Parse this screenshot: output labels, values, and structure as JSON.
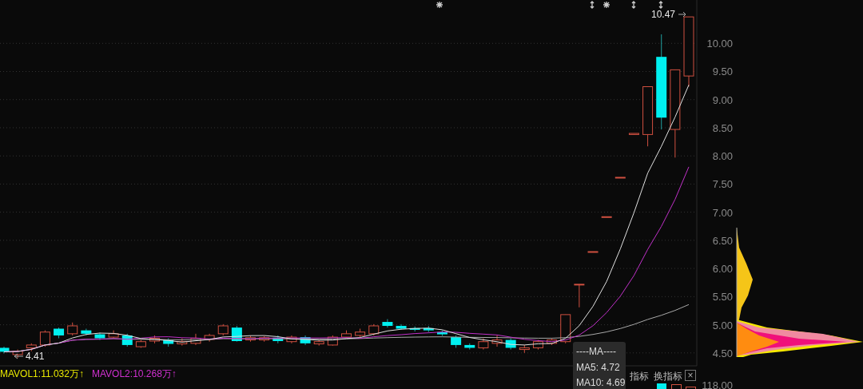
{
  "chart": {
    "high_label": "10.47",
    "low_label": "4.41",
    "chart_data": {
      "type": "candlestick",
      "grid": true,
      "ylim": [
        4.27,
        10.77
      ],
      "yticks": [
        {
          "value": 4.5,
          "label": "4.50"
        },
        {
          "value": 5,
          "label": "5.00"
        },
        {
          "value": 5.5,
          "label": "5.50"
        },
        {
          "value": 6,
          "label": "6.00"
        },
        {
          "value": 6.5,
          "label": "6.50"
        },
        {
          "value": 7,
          "label": "7.00"
        },
        {
          "value": 7.5,
          "label": "7.50"
        },
        {
          "value": 8,
          "label": "8.00"
        },
        {
          "value": 8.5,
          "label": "8.50"
        },
        {
          "value": 9,
          "label": "9.00"
        },
        {
          "value": 9.5,
          "label": "9.50"
        },
        {
          "value": 10,
          "label": "10.00"
        }
      ],
      "ohlc": [
        [
          4.59,
          4.61,
          4.49,
          4.52
        ],
        [
          4.47,
          4.56,
          4.41,
          4.53
        ],
        [
          4.59,
          4.67,
          4.53,
          4.64
        ],
        [
          4.64,
          4.9,
          4.61,
          4.87
        ],
        [
          4.93,
          4.95,
          4.76,
          4.81
        ],
        [
          4.84,
          5.04,
          4.81,
          4.98
        ],
        [
          4.9,
          4.93,
          4.81,
          4.84
        ],
        [
          4.83,
          4.86,
          4.73,
          4.76
        ],
        [
          4.78,
          4.9,
          4.76,
          4.84
        ],
        [
          4.81,
          4.84,
          4.61,
          4.64
        ],
        [
          4.61,
          4.73,
          4.59,
          4.7
        ],
        [
          4.71,
          4.81,
          4.67,
          4.76
        ],
        [
          4.73,
          4.76,
          4.61,
          4.66
        ],
        [
          4.66,
          4.76,
          4.63,
          4.7
        ],
        [
          4.67,
          4.84,
          4.64,
          4.76
        ],
        [
          4.74,
          4.84,
          4.7,
          4.81
        ],
        [
          4.84,
          5.01,
          4.81,
          4.98
        ],
        [
          4.95,
          4.98,
          4.7,
          4.71
        ],
        [
          4.73,
          4.81,
          4.7,
          4.77
        ],
        [
          4.73,
          4.8,
          4.7,
          4.77
        ],
        [
          4.77,
          4.81,
          4.67,
          4.71
        ],
        [
          4.7,
          4.81,
          4.67,
          4.78
        ],
        [
          4.78,
          4.81,
          4.64,
          4.67
        ],
        [
          4.66,
          4.73,
          4.63,
          4.7
        ],
        [
          4.64,
          4.81,
          4.63,
          4.78
        ],
        [
          4.78,
          4.9,
          4.76,
          4.84
        ],
        [
          4.81,
          4.93,
          4.78,
          4.87
        ],
        [
          4.84,
          5.01,
          4.81,
          4.98
        ],
        [
          5.05,
          5.1,
          4.95,
          4.98
        ],
        [
          4.98,
          5.01,
          4.91,
          4.93
        ],
        [
          4.94,
          4.97,
          4.88,
          4.91
        ],
        [
          4.94,
          4.98,
          4.87,
          4.9
        ],
        [
          4.87,
          4.9,
          4.8,
          4.83
        ],
        [
          4.78,
          4.81,
          4.59,
          4.64
        ],
        [
          4.64,
          4.67,
          4.56,
          4.59
        ],
        [
          4.59,
          4.76,
          4.56,
          4.7
        ],
        [
          4.67,
          4.81,
          4.61,
          4.73
        ],
        [
          4.73,
          4.76,
          4.56,
          4.59
        ],
        [
          4.56,
          4.64,
          4.5,
          4.59
        ],
        [
          4.59,
          4.73,
          4.56,
          4.7
        ],
        [
          4.67,
          4.76,
          4.64,
          4.73
        ],
        [
          4.7,
          5.18,
          4.67,
          5.18
        ],
        [
          5.72,
          5.72,
          5.31,
          5.72
        ],
        [
          6.3,
          6.3,
          6.3,
          6.3
        ],
        [
          6.92,
          6.92,
          6.92,
          6.92
        ],
        [
          7.62,
          7.62,
          7.62,
          7.62
        ],
        [
          8.38,
          8.4,
          8.38,
          8.4
        ],
        [
          8.38,
          9.23,
          8.17,
          9.23
        ],
        [
          9.76,
          10.16,
          8.47,
          8.68
        ],
        [
          8.47,
          9.53,
          7.97,
          9.53
        ],
        [
          9.42,
          10.47,
          9.23,
          10.47
        ]
      ]
    }
  },
  "indicator_bar": {
    "mavol": [
      {
        "text": "MAVOL1:11.032万↑",
        "color": "#e8e800"
      },
      {
        "text": "MAVOL2:10.268万↑",
        "color": "#d030d0"
      }
    ],
    "buttons": [
      "指标",
      "换指标"
    ],
    "close": "×",
    "volume_tick": "118.00"
  },
  "tooltip": {
    "title": "----MA----",
    "lines": [
      "MA5: 4.72",
      "MA10: 4.69"
    ]
  }
}
